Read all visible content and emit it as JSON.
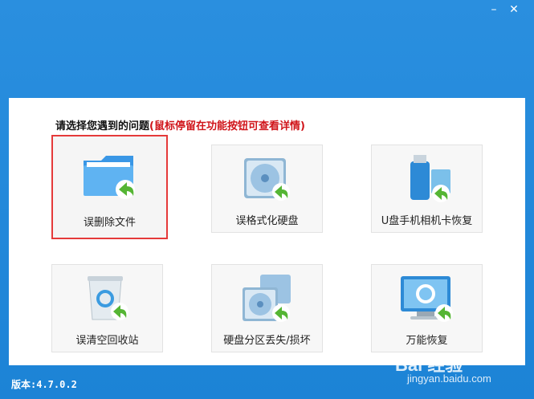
{
  "window": {
    "minimize_glyph": "–",
    "close_glyph": "✕"
  },
  "prompt": {
    "main": "请选择您遇到的问题",
    "hint": "(鼠标停留在功能按钮可查看详情)"
  },
  "tiles": [
    {
      "label": "误删除文件",
      "icon": "folder-restore-icon"
    },
    {
      "label": "误格式化硬盘",
      "icon": "harddisk-restore-icon"
    },
    {
      "label": "U盘手机相机卡恢复",
      "icon": "usb-card-restore-icon"
    },
    {
      "label": "误清空回收站",
      "icon": "recycle-bin-restore-icon"
    },
    {
      "label": "硬盘分区丢失/损坏",
      "icon": "partition-restore-icon"
    },
    {
      "label": "万能恢复",
      "icon": "monitor-restore-icon"
    }
  ],
  "version": "版本:4.7.0.2",
  "watermark": {
    "logo": "Bai 经验",
    "url": "jingyan.baidu.com"
  },
  "colors": {
    "accent": "#1f86d8",
    "selected_border": "#e53a3a",
    "hint_text": "#d0141a",
    "arrow": "#55b534"
  }
}
